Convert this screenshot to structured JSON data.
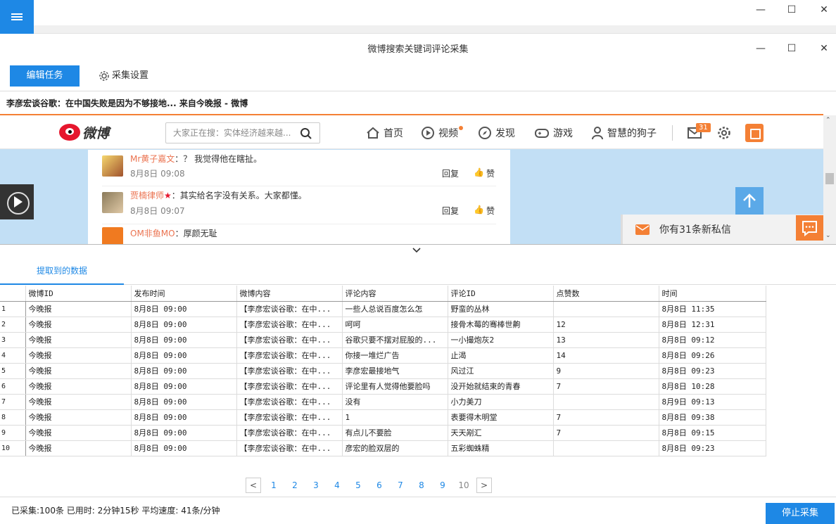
{
  "window": {
    "title": "微博搜索关键词评论采集",
    "controls": {
      "minimize": "—",
      "maximize": "☐",
      "close": "✕"
    }
  },
  "toolbar": {
    "edit_task": "编辑任务",
    "collect_settings": "采集设置"
  },
  "address_bar": "李彦宏谈谷歌：在中国失败是因为不够接地... 来自今晚报 - 微博",
  "weibo": {
    "logo_text": "微博",
    "search_placeholder": "大家正在搜：实体经济越来越...",
    "nav": {
      "home": "首页",
      "video": "视频",
      "discover": "发现",
      "games": "游戏",
      "user": "智慧的狗子",
      "message_badge": "31"
    },
    "comments": [
      {
        "user": "Mr黄子嘉文",
        "text": "：？ 我觉得他在瞎扯。",
        "time": "8月8日 09:08",
        "reply": "回复",
        "like": "赞"
      },
      {
        "user": "贾楠律师",
        "text": "：其实给名字没有关系。大家都懂。",
        "time": "8月8日 09:07",
        "reply": "回复",
        "like": "赞"
      },
      {
        "user": "OM非鱼MO",
        "text": "：厚颜无耻"
      }
    ],
    "private_message": "你有31条新私信"
  },
  "data_tab": {
    "label": "提取到的数据"
  },
  "grid": {
    "columns": [
      "微博ID",
      "发布时间",
      "微博内容",
      "评论内容",
      "评论ID",
      "点赞数",
      "时间"
    ],
    "rows": [
      [
        "1",
        "今晚报",
        "8月8日 09:00",
        "【李彦宏谈谷歌：在中...",
        "一些人总说百度怎么怎",
        "野蛮的丛林",
        "",
        "8月8日 11:35"
      ],
      [
        "2",
        "今晚报",
        "8月8日 09:00",
        "【李彦宏谈谷歌：在中...",
        "呵呵",
        "接骨木莓的骞棒世齁",
        "12",
        "8月8日 12:31"
      ],
      [
        "3",
        "今晚报",
        "8月8日 09:00",
        "【李彦宏谈谷歌：在中...",
        "谷歌只要不摆对屁股的...",
        "一小撮炮灰2",
        "13",
        "8月8日 09:12"
      ],
      [
        "4",
        "今晚报",
        "8月8日 09:00",
        "【李彦宏谈谷歌：在中...",
        "你接一堆烂广告",
        "止渴",
        "14",
        "8月8日 09:26"
      ],
      [
        "5",
        "今晚报",
        "8月8日 09:00",
        "【李彦宏谈谷歌：在中...",
        "李彦宏最接地气",
        "风过江",
        "9",
        "8月8日 09:23"
      ],
      [
        "6",
        "今晚报",
        "8月8日 09:00",
        "【李彦宏谈谷歌：在中...",
        "评论里有人觉得他要脸吗",
        "没开始就结束的青春",
        "7",
        "8月8日 10:28"
      ],
      [
        "7",
        "今晚报",
        "8月8日 09:00",
        "【李彦宏谈谷歌：在中...",
        "没有",
        "小力美刀",
        "",
        "8月9日 09:13"
      ],
      [
        "8",
        "今晚报",
        "8月8日 09:00",
        "【李彦宏谈谷歌：在中...",
        "1",
        "表要得木明堂",
        "7",
        "8月8日 09:38"
      ],
      [
        "9",
        "今晚报",
        "8月8日 09:00",
        "【李彦宏谈谷歌：在中...",
        "有点儿不要脸",
        "天天剐汇",
        "7",
        "8月8日 09:15"
      ],
      [
        "10",
        "今晚报",
        "8月8日 09:00",
        "【李彦宏谈谷歌：在中...",
        "彦宏的脸双层的",
        "五彩蜘蛛精",
        "",
        "8月8日 09:23"
      ]
    ]
  },
  "pager": {
    "prev": "<",
    "next": ">",
    "pages": [
      "1",
      "2",
      "3",
      "4",
      "5",
      "6",
      "7",
      "8",
      "9",
      "10"
    ],
    "current": "10"
  },
  "status": {
    "text": "已采集:100条  已用时: 2分钟15秒 平均速度: 41条/分钟",
    "stop_button": "停止采集"
  },
  "colors": {
    "accent": "#1e88e5",
    "weibo_orange": "#f48035",
    "weibo_red": "#e6162d"
  }
}
